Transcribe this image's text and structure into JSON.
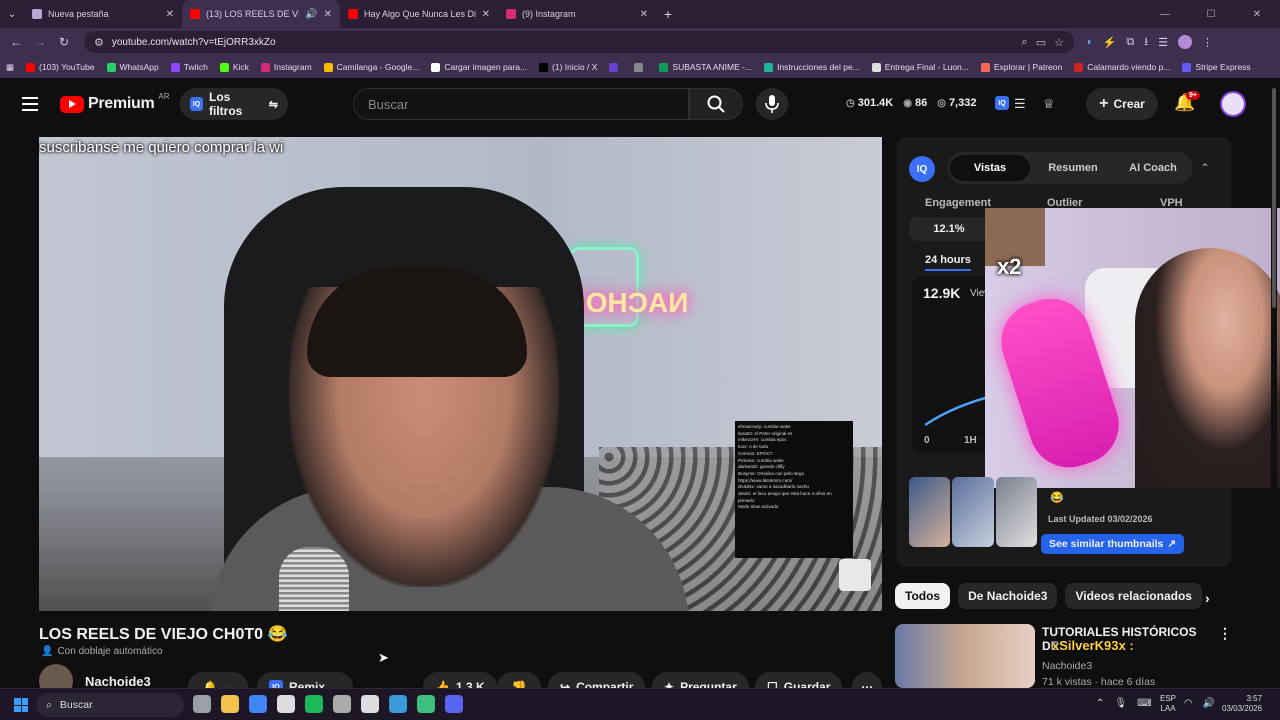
{
  "browser": {
    "tabs": [
      {
        "title": "Nueva pestaña",
        "color": "#b9a6d6"
      },
      {
        "title": "(13) LOS REELS DE VIEJO C",
        "color": "#ff0000"
      },
      {
        "title": "Hay Algo Que Nunca Les Dije -",
        "color": "#ff0000"
      },
      {
        "title": "(9) Instagram",
        "color": "#d62976"
      }
    ],
    "url": "youtube.com/watch?v=tEjORR3xkZo",
    "bookmarks": [
      {
        "label": "(103) YouTube",
        "color": "#ff0000"
      },
      {
        "label": "WhatsApp",
        "color": "#25d366"
      },
      {
        "label": "Twitch",
        "color": "#9146ff"
      },
      {
        "label": "Kick",
        "color": "#53fc18"
      },
      {
        "label": "Instagram",
        "color": "#d62976"
      },
      {
        "label": "Camilanga - Google...",
        "color": "#fbbc04"
      },
      {
        "label": "Cargar imagen para...",
        "color": "#ffffff"
      },
      {
        "label": "(1) Inicio / X",
        "color": "#000000"
      },
      {
        "label": "",
        "color": "#6b3fd0"
      },
      {
        "label": "",
        "color": "#888888"
      },
      {
        "label": "SUBASTA ANIME -...",
        "color": "#0f9d58"
      },
      {
        "label": "Instrucciones del pe...",
        "color": "#1fb59a"
      },
      {
        "label": "Entrega Final - Luon...",
        "color": "#dddddd"
      },
      {
        "label": "Explorar | Patreon",
        "color": "#f96854"
      },
      {
        "label": "Calamardo viendo p...",
        "color": "#cc2222"
      },
      {
        "label": "Stripe Express",
        "color": "#635bff"
      }
    ]
  },
  "youtube": {
    "brand": "Premium",
    "country": "AR",
    "filters_label": "Los filtros",
    "search_placeholder": "Buscar",
    "stats": {
      "subs": "301.4K",
      "videos": "86",
      "views": "7,332"
    },
    "create_label": "Crear",
    "notif_badge": "9+"
  },
  "video": {
    "caption": "suscribanse me quiero comprar la wi",
    "neon_text": "NACHOIDE",
    "chat_lines": [
      "elmascrazy: cumbia wake",
      "lana03: el Peter original es",
      "mikecorre: cumbia epoc",
      "tuxx: A de todo",
      "Cerruso: EPOC?",
      "Pelusso: cumbia wake",
      "darkwaltz: grande cliffy",
      "Busyme: Omision con pelo largo",
      "",
      "https://www.tiktokmm.com/",
      "",
      "drukitsx: vamo a sacudharlo nacho",
      "davito: el facu amigo que esta hace 4 años en",
      "primario",
      "Modo slow activado"
    ],
    "title": "LOS REELS DE VIEJO CH0T0",
    "title_emoji": "😂",
    "dub_label": "Con doblaje automático",
    "channel": "Nachoide3",
    "remix_label": "Remix",
    "likes": "1.3 K",
    "share_label": "Compartir",
    "ask_label": "Preguntar",
    "save_label": "Guardar"
  },
  "panel": {
    "tabs": [
      "Vistas",
      "Resumen",
      "AI Coach"
    ],
    "active_tab": "Vistas",
    "columns": [
      "Engagement",
      "Outlier",
      "VPH"
    ],
    "engagement": "12.1%",
    "period": "24 hours",
    "views_value": "12.9K",
    "views_label": "Views",
    "x_ticks": [
      "0",
      "1H"
    ],
    "last_updated": "Last Updated 03/02/2026",
    "similar_label": "See similar thumbnails",
    "overlay_text": "x2"
  },
  "chips": [
    "Todos",
    "De Nachoide3",
    "Videos relacionados"
  ],
  "related": {
    "title": "TUTORIALES HISTÓRICOS DE",
    "channel": "Nachoide3",
    "meta": "71 k vistas · hace 6 días",
    "overlay_name": "xSilverK93x :"
  },
  "taskbar": {
    "search_placeholder": "Buscar",
    "lang1": "ESP",
    "lang2": "LAA",
    "time": "3:57",
    "date": "03/03/2026",
    "apps": [
      "#9aa0a6",
      "#f2c14e",
      "#4285f4",
      "#dddddd",
      "#1db954",
      "#aaaaaa",
      "#dddddd",
      "#3a9ad9",
      "#3fbf7f",
      "#5865f2"
    ]
  }
}
